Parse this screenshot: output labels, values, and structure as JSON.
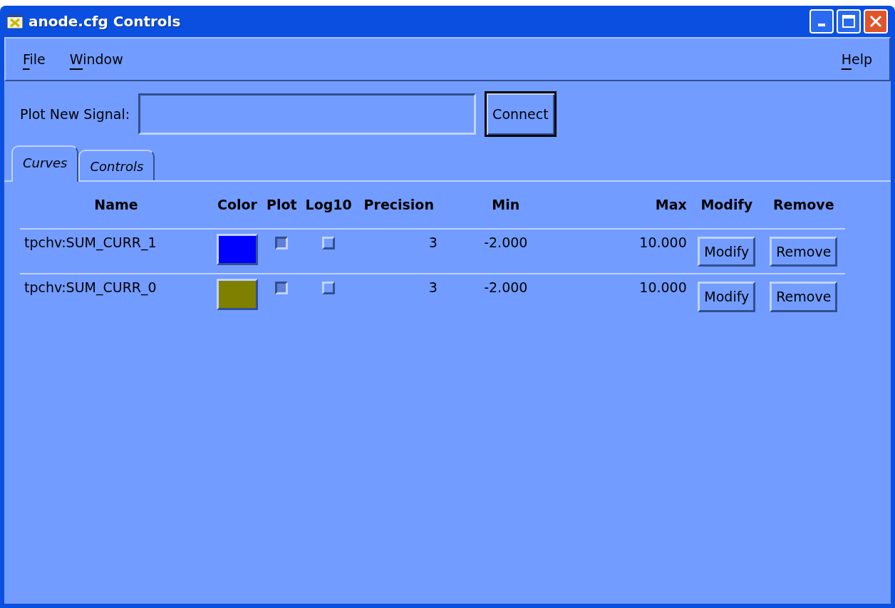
{
  "window": {
    "title": "anode.cfg Controls"
  },
  "menu": {
    "left": [
      {
        "label": "File"
      },
      {
        "label": "Window"
      }
    ],
    "right": [
      {
        "label": "Help"
      }
    ]
  },
  "signal": {
    "label": "Plot New Signal:",
    "button": "Connect"
  },
  "tabs": [
    {
      "label": "Curves",
      "selected": true
    },
    {
      "label": "Controls",
      "selected": false
    }
  ],
  "table": {
    "columns": [
      "Name",
      "Color",
      "Plot",
      "Log10",
      "Precision",
      "Min",
      "Max",
      "Modify",
      "Remove"
    ],
    "rows": [
      {
        "name": "tpchv:SUM_CURR_1",
        "color": "#0000ff",
        "plot": true,
        "log10": false,
        "precision": "3",
        "min": "-2.000",
        "max": "10.000",
        "modify": "Modify",
        "remove": "Remove"
      },
      {
        "name": "tpchv:SUM_CURR_0",
        "color": "#808000",
        "plot": true,
        "log10": false,
        "precision": "3",
        "min": "-2.000",
        "max": "10.000",
        "modify": "Modify",
        "remove": "Remove"
      }
    ]
  }
}
